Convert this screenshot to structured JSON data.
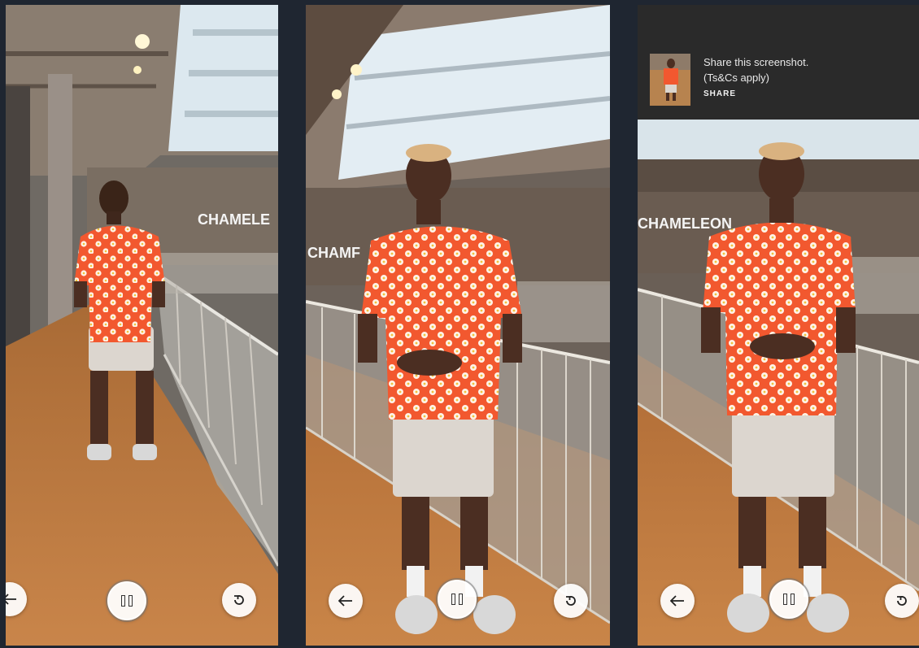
{
  "panels": [
    {
      "id": "p1",
      "view": "back",
      "sign": "CHAMELE",
      "sign2": ""
    },
    {
      "id": "p2",
      "view": "front",
      "sign": "CHAMF",
      "sign2": ""
    },
    {
      "id": "p3",
      "view": "front",
      "sign": "CHAMELEON",
      "sign2": ""
    }
  ],
  "controls": {
    "back_icon": "arrow-left-icon",
    "pause_icon": "pause-icon",
    "replay_icon": "replay-icon"
  },
  "share": {
    "line1": "Share this screenshot.",
    "line2": "(Ts&Cs apply)",
    "action": "SHARE"
  },
  "colors": {
    "background": "#1f2631",
    "shirt": "#f2582f",
    "floor": "#c27a3f",
    "banner": "#2a2a2a"
  }
}
